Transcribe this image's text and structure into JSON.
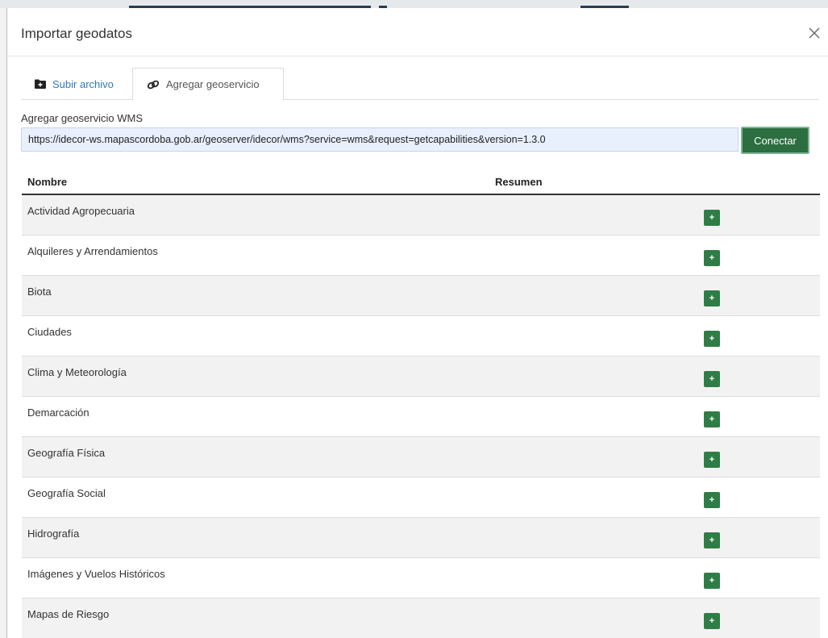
{
  "modal": {
    "title": "Importar geodatos"
  },
  "tabs": [
    {
      "label": "Subir archivo",
      "icon": "folder-icon",
      "active": false
    },
    {
      "label": "Agregar geoservicio",
      "icon": "link-icon",
      "active": true
    }
  ],
  "wms": {
    "label": "Agregar geoservicio WMS",
    "url": "https://idecor-ws.mapascordoba.gob.ar/geoserver/idecor/wms?service=wms&request=getcapabilities&version=1.3.0",
    "connect_label": "Conectar"
  },
  "table": {
    "headers": {
      "name": "Nombre",
      "summary": "Resumen"
    },
    "add_label": "+",
    "rows": [
      {
        "name": "Actividad Agropecuaria",
        "summary": ""
      },
      {
        "name": "Alquileres y Arrendamientos",
        "summary": ""
      },
      {
        "name": "Biota",
        "summary": ""
      },
      {
        "name": "Ciudades",
        "summary": ""
      },
      {
        "name": "Clima y Meteorología",
        "summary": ""
      },
      {
        "name": "Demarcación",
        "summary": ""
      },
      {
        "name": "Geografía Física",
        "summary": ""
      },
      {
        "name": "Geografía Social",
        "summary": ""
      },
      {
        "name": "Hidrografía",
        "summary": ""
      },
      {
        "name": "Imágenes y Vuelos Históricos",
        "summary": ""
      },
      {
        "name": "Mapas de Riesgo",
        "summary": ""
      }
    ]
  },
  "colors": {
    "accent_green": "#2f7d46",
    "connect_green": "#2c6e3f",
    "link_blue": "#337ab7",
    "input_bg": "#e8f0fe",
    "row_alt": "#f2f2f2"
  }
}
